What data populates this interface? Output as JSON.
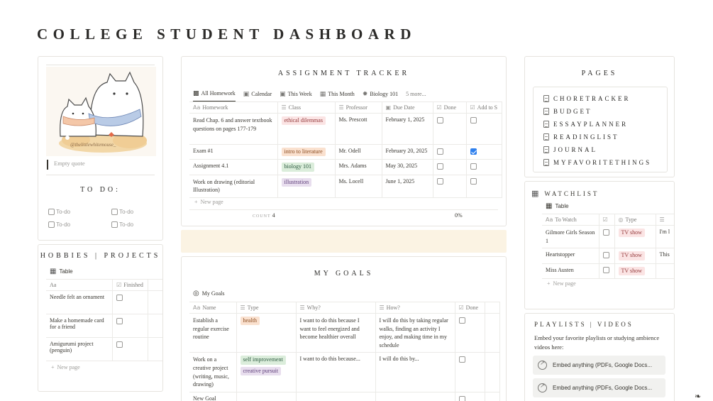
{
  "page": {
    "title": "COLLEGE STUDENT DASHBOARD"
  },
  "quote": {
    "placeholder": "Empty quote",
    "image_credit": "@thelittlewhitemouse_"
  },
  "todo": {
    "heading": "TO DO:",
    "items": [
      "To-do",
      "To-do",
      "To-do",
      "To-do"
    ]
  },
  "hobbies": {
    "heading": "HOBBIES | PROJECTS",
    "view": "Table",
    "col_name_icon": "Aa",
    "col_finished": "Finished",
    "rows": [
      {
        "name": "Needle felt an ornament",
        "done": false
      },
      {
        "name": "Make a homemade card for a friend",
        "done": false
      },
      {
        "name": "Amigurumi project (penguin)",
        "done": false
      }
    ],
    "new_page": "New page"
  },
  "assignments": {
    "heading": "ASSIGNMENT TRACKER",
    "tabs": [
      "All Homework",
      "Calendar",
      "This Week",
      "This Month",
      "Biology 101",
      "5 more..."
    ],
    "columns": [
      "Homework",
      "Class",
      "Professor",
      "Due Date",
      "Done",
      "Add to S"
    ],
    "rows": [
      {
        "homework": "Read Chap. 6 and answer textbook questions on pages 177-179",
        "class": "ethical dilemmas",
        "class_color": "#fbe4e4",
        "class_text": "#93383a",
        "professor": "Ms. Prescott",
        "due": "February 1, 2025",
        "done": false,
        "add": false
      },
      {
        "homework": "Exam #1",
        "class": "intro to literature",
        "class_color": "#fae1cf",
        "class_text": "#8a4b1f",
        "professor": "Mr. Odell",
        "due": "February 20, 2025",
        "done": false,
        "add": true
      },
      {
        "homework": "Assignment 4.1",
        "class": "biology 101",
        "class_color": "#fdecc8",
        "class_text": "#7a5a1a",
        "professor": "Mrs. Adams",
        "due": "May 30, 2025",
        "done": false,
        "add": false
      },
      {
        "homework": "Work on drawing (editorial Illustration)",
        "class": "illustration",
        "class_color": "#e8deee",
        "class_text": "#5e3f7a",
        "professor": "Ms. Locell",
        "due": "June 1, 2025",
        "done": false,
        "add": false
      }
    ],
    "new_page": "New page",
    "count_label": "COUNT",
    "count_value": "4",
    "percent": "0%"
  },
  "goals": {
    "heading": "MY GOALS",
    "view": "My Goals",
    "columns": [
      "Name",
      "Type",
      "Why?",
      "How?",
      "Done"
    ],
    "rows": [
      {
        "name": "Establish a regular exercise routine",
        "types": [
          {
            "label": "health",
            "bg": "#fae1cf",
            "fg": "#8a4b1f"
          }
        ],
        "why": "I want to do this because I want to feel energized and become healthier overall",
        "how": "I will do this by taking regular walks, finding an activity I enjoy, and making time in my schedule",
        "done": false
      },
      {
        "name": "Work on a creative project (writing, music, drawing)",
        "types": [
          {
            "label": "self improvement",
            "bg": "#dbeddb",
            "fg": "#2b593f"
          },
          {
            "label": "creative pursuit",
            "bg": "#e8deee",
            "fg": "#5e3f7a"
          }
        ],
        "why": "I want to do this because...",
        "how": "I will do this by...",
        "done": false
      },
      {
        "name": "New Goal",
        "types": [],
        "why": "",
        "how": "",
        "done": false
      }
    ]
  },
  "pages": {
    "heading": "PAGES",
    "links": [
      "CHORETRACKER",
      "BUDGET",
      "ESSAYPLANNER",
      "READINGLIST",
      "JOURNAL",
      "MYFAVORITETHINGS"
    ]
  },
  "watchlist": {
    "heading": "WATCHLIST",
    "view": "Table",
    "columns": [
      "To Watch",
      "Type"
    ],
    "rows": [
      {
        "title": "Gilmore Girls Season 1",
        "type": "TV show",
        "note": "I'm l"
      },
      {
        "title": "Heartstopper",
        "type": "TV show",
        "note": "This"
      },
      {
        "title": "Miss Austen",
        "type": "TV show",
        "note": ""
      }
    ],
    "new_page": "New page"
  },
  "playlists": {
    "heading": "PLAYLISTS | VIDEOS",
    "description": "Embed your favorite playlists or studying ambience videos here:",
    "embeds": [
      "Embed anything (PDFs, Google Docs...",
      "Embed anything (PDFs, Google Docs..."
    ]
  },
  "colors": {
    "accent_blue": "#2f80ed",
    "banner": "#fbf3e3",
    "tag_tv": "#fbe4e4"
  }
}
